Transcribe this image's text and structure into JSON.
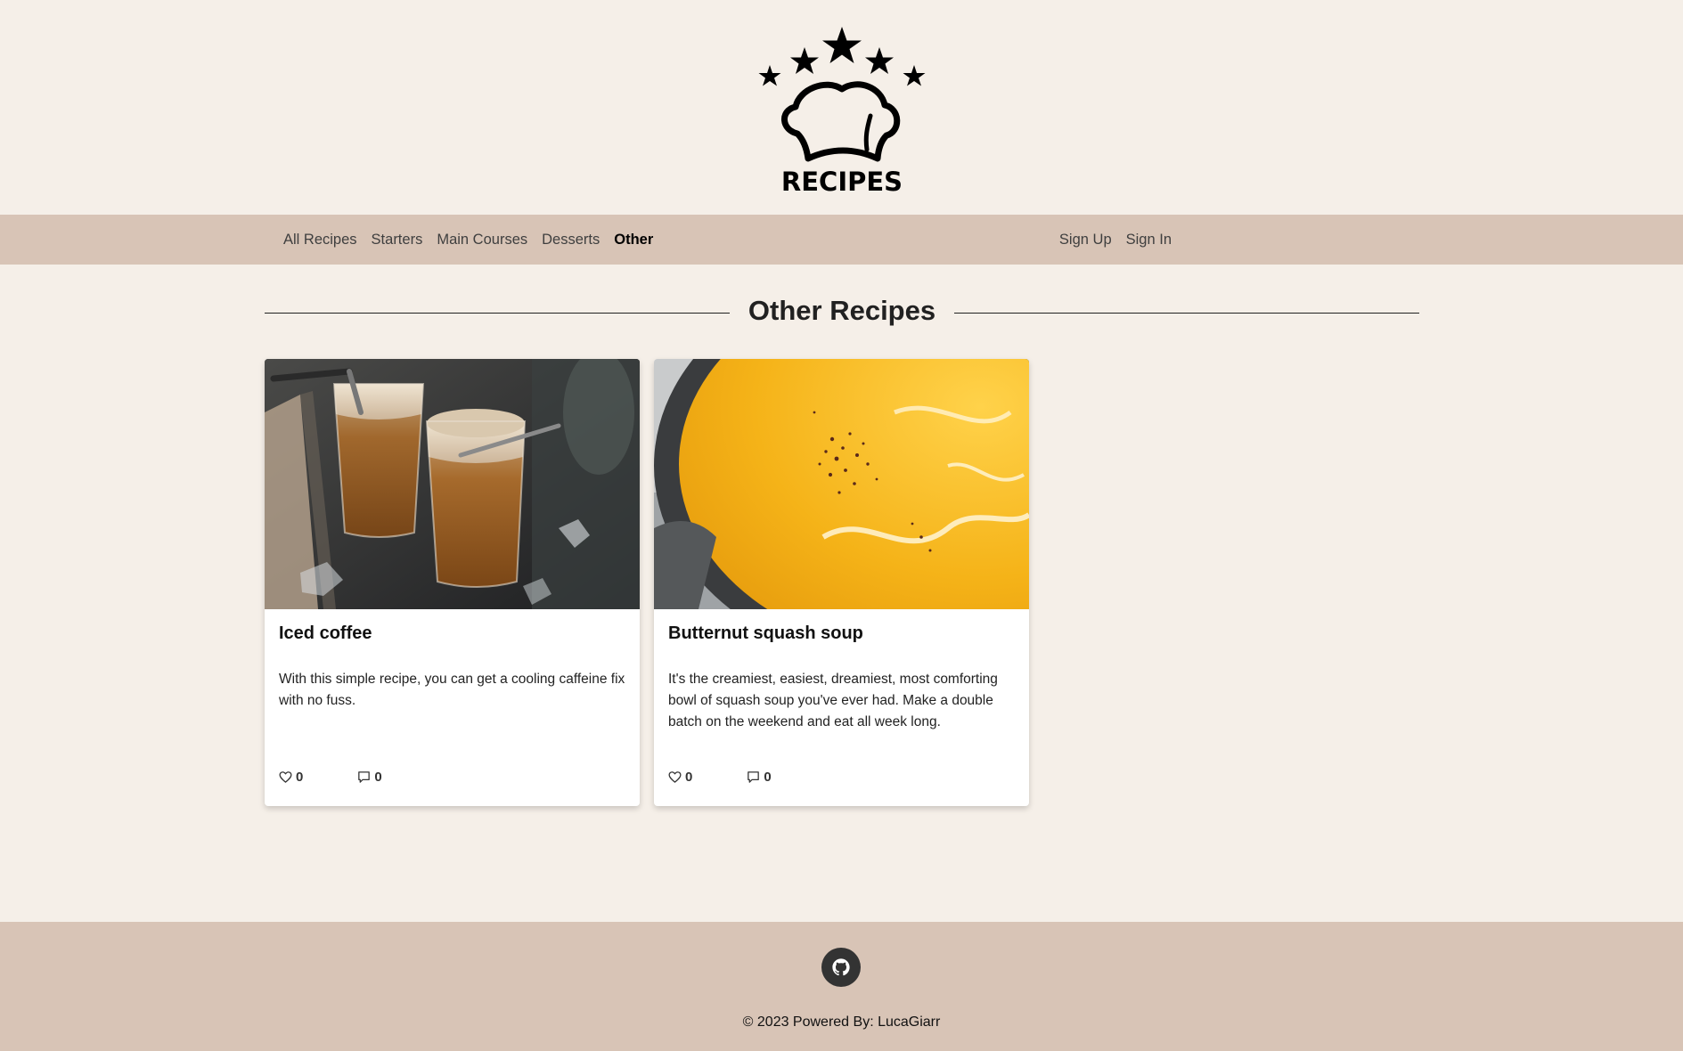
{
  "brand": {
    "logo_text": "RECIPES"
  },
  "nav": {
    "left": [
      {
        "label": "All Recipes",
        "active": false
      },
      {
        "label": "Starters",
        "active": false
      },
      {
        "label": "Main Courses",
        "active": false
      },
      {
        "label": "Desserts",
        "active": false
      },
      {
        "label": "Other",
        "active": true
      }
    ],
    "right": [
      {
        "label": "Sign Up"
      },
      {
        "label": "Sign In"
      }
    ]
  },
  "page": {
    "title": "Other Recipes"
  },
  "cards": [
    {
      "title": "Iced coffee",
      "description": "With this simple recipe, you can get a cooling caffeine fix with no fuss.",
      "likes": "0",
      "comments": "0"
    },
    {
      "title": "Butternut squash soup",
      "description": "It's the creamiest, easiest, dreamiest, most comforting bowl of squash soup you've ever had. Make a double batch on the weekend and eat all week long.",
      "likes": "0",
      "comments": "0"
    }
  ],
  "footer": {
    "copyright": "© 2023 Powered By: LucaGiarr",
    "social_icon": "github-icon"
  },
  "colors": {
    "page_bg": "#f5efe8",
    "nav_bg": "#d8c4b6",
    "footer_bg": "#d8c4b6",
    "github_button": "#333333"
  }
}
